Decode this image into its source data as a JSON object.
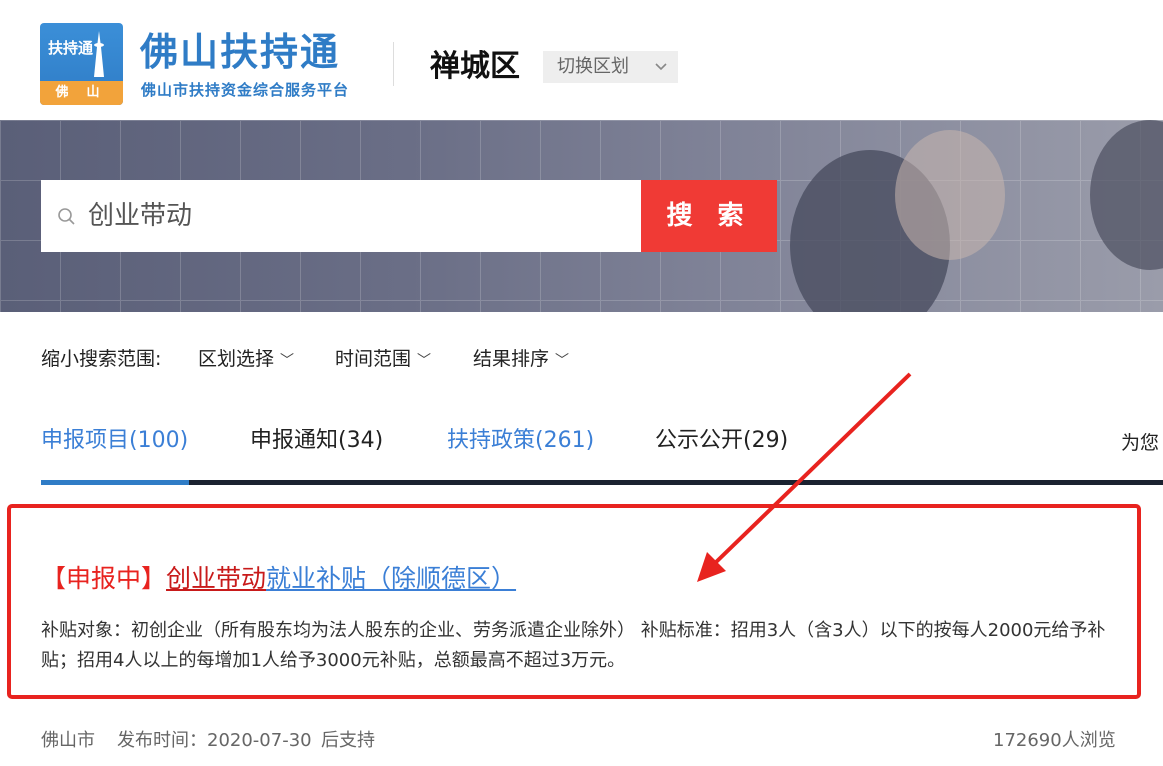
{
  "header": {
    "logo_top": "扶持通",
    "logo_bottom": "佛山",
    "brand_title": "佛山扶持通",
    "brand_subtitle": "佛山市扶持资金综合服务平台",
    "region_name": "禅城区",
    "region_switch_label": "切换区划"
  },
  "search": {
    "query": "创业带动",
    "button_label": "搜 索"
  },
  "filters": {
    "label": "缩小搜索范围:",
    "items": [
      "区划选择",
      "时间范围",
      "结果排序"
    ]
  },
  "tabs": [
    {
      "label": "申报项目(100)",
      "active": true
    },
    {
      "label": "申报通知(34)",
      "active": false
    },
    {
      "label": "扶持政策(261)",
      "active": false
    },
    {
      "label": "公示公开(29)",
      "active": false
    }
  ],
  "tab_right_text": "为您",
  "result": {
    "status": "【申报中】",
    "keyword": "创业带动",
    "title_rest": "就业补贴（除顺德区）",
    "description": "补贴对象：初创企业（所有股东均为法人股东的企业、劳务派遣企业除外） 补贴标准：招用3人（含3人）以下的按每人2000元给予补贴；招用4人以上的每增加1人给予3000元补贴，总额最高不超过3万元。"
  },
  "meta": {
    "city": "佛山市",
    "publish_label": "发布时间：2020-07-30",
    "support_type": "后支持",
    "views": "172690人浏览"
  },
  "colors": {
    "brand_blue": "#2f7cc6",
    "search_red": "#f03a35",
    "highlight_red": "#e8231f",
    "link_blue": "#3b7fd6"
  }
}
